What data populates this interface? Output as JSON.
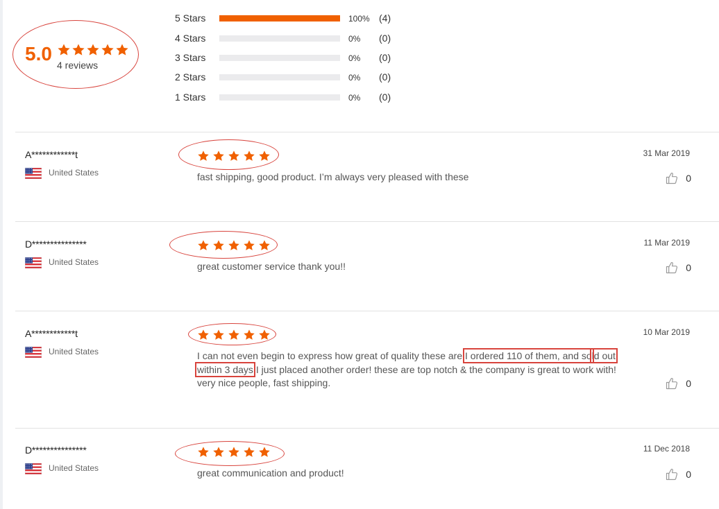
{
  "summary": {
    "average": "5.0",
    "rating_stars": 5,
    "review_count": "4 reviews",
    "distribution": [
      {
        "label": "5 Stars",
        "fill": 1.0,
        "percent": "100%",
        "count": "(4)"
      },
      {
        "label": "4 Stars",
        "fill": 0.0,
        "percent": "0%",
        "count": "(0)"
      },
      {
        "label": "3 Stars",
        "fill": 0.0,
        "percent": "0%",
        "count": "(0)"
      },
      {
        "label": "2 Stars",
        "fill": 0.0,
        "percent": "0%",
        "count": "(0)"
      },
      {
        "label": "1 Stars",
        "fill": 0.0,
        "percent": "0%",
        "count": "(0)"
      }
    ]
  },
  "reviews": [
    {
      "user": "A************t",
      "country": "United States",
      "stars": 5,
      "date": "31 Mar 2019",
      "text": "fast shipping, good product. I’m always very pleased with these",
      "likes": "0"
    },
    {
      "user": "D***************",
      "country": "United States",
      "stars": 5,
      "date": "11 Mar 2019",
      "text": "great customer service thank you!!",
      "likes": "0"
    },
    {
      "user": "A************t",
      "country": "United States",
      "stars": 5,
      "date": "10 Mar 2019",
      "text_part1": "I can not even begin to express how great of quality these are!",
      "text_highlight1": "I ordered 110 of them, and so",
      "text_highlight2": "ld out within 3 days",
      "text_part2": " I just placed another order! these are top notch & the company is great to work with! very nice people, fast shipping.",
      "likes": "0"
    },
    {
      "user": "D***************",
      "country": "United States",
      "stars": 5,
      "date": "11 Dec 2018",
      "text": "great communication and product!",
      "likes": "0"
    }
  ],
  "colors": {
    "accent": "#f06000",
    "annotation": "#d8433c",
    "bar_empty": "#ebebed"
  },
  "icons": {
    "star": "star-icon",
    "flag": "us-flag-icon",
    "like": "thumbs-up-icon"
  }
}
